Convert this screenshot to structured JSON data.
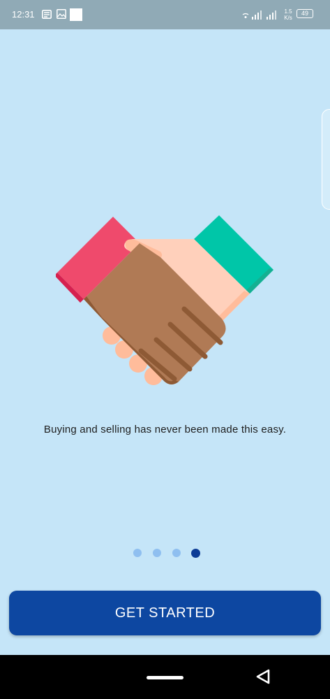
{
  "status_bar": {
    "time": "12:31",
    "net_speed_value": "1.5",
    "net_speed_unit": "K/s",
    "battery_level": "49",
    "left_icons": [
      "notification-icon",
      "image-icon",
      "blank-app-icon"
    ],
    "right_icons": [
      "wifi-icon",
      "signal-icon",
      "signal-icon",
      "battery-icon"
    ]
  },
  "onboarding": {
    "illustration": "handshake-illustration",
    "tagline": "Buying and selling has never been made this easy.",
    "page_count": 4,
    "active_page": 4
  },
  "cta": {
    "label": "GET STARTED",
    "color": "#0d47a1"
  },
  "colors": {
    "background": "#c5e5f8",
    "dot_inactive": "#8fbff0",
    "dot_active": "#0d3c96"
  },
  "nav_bar": {
    "icons": [
      "home-pill-icon",
      "back-icon"
    ]
  }
}
